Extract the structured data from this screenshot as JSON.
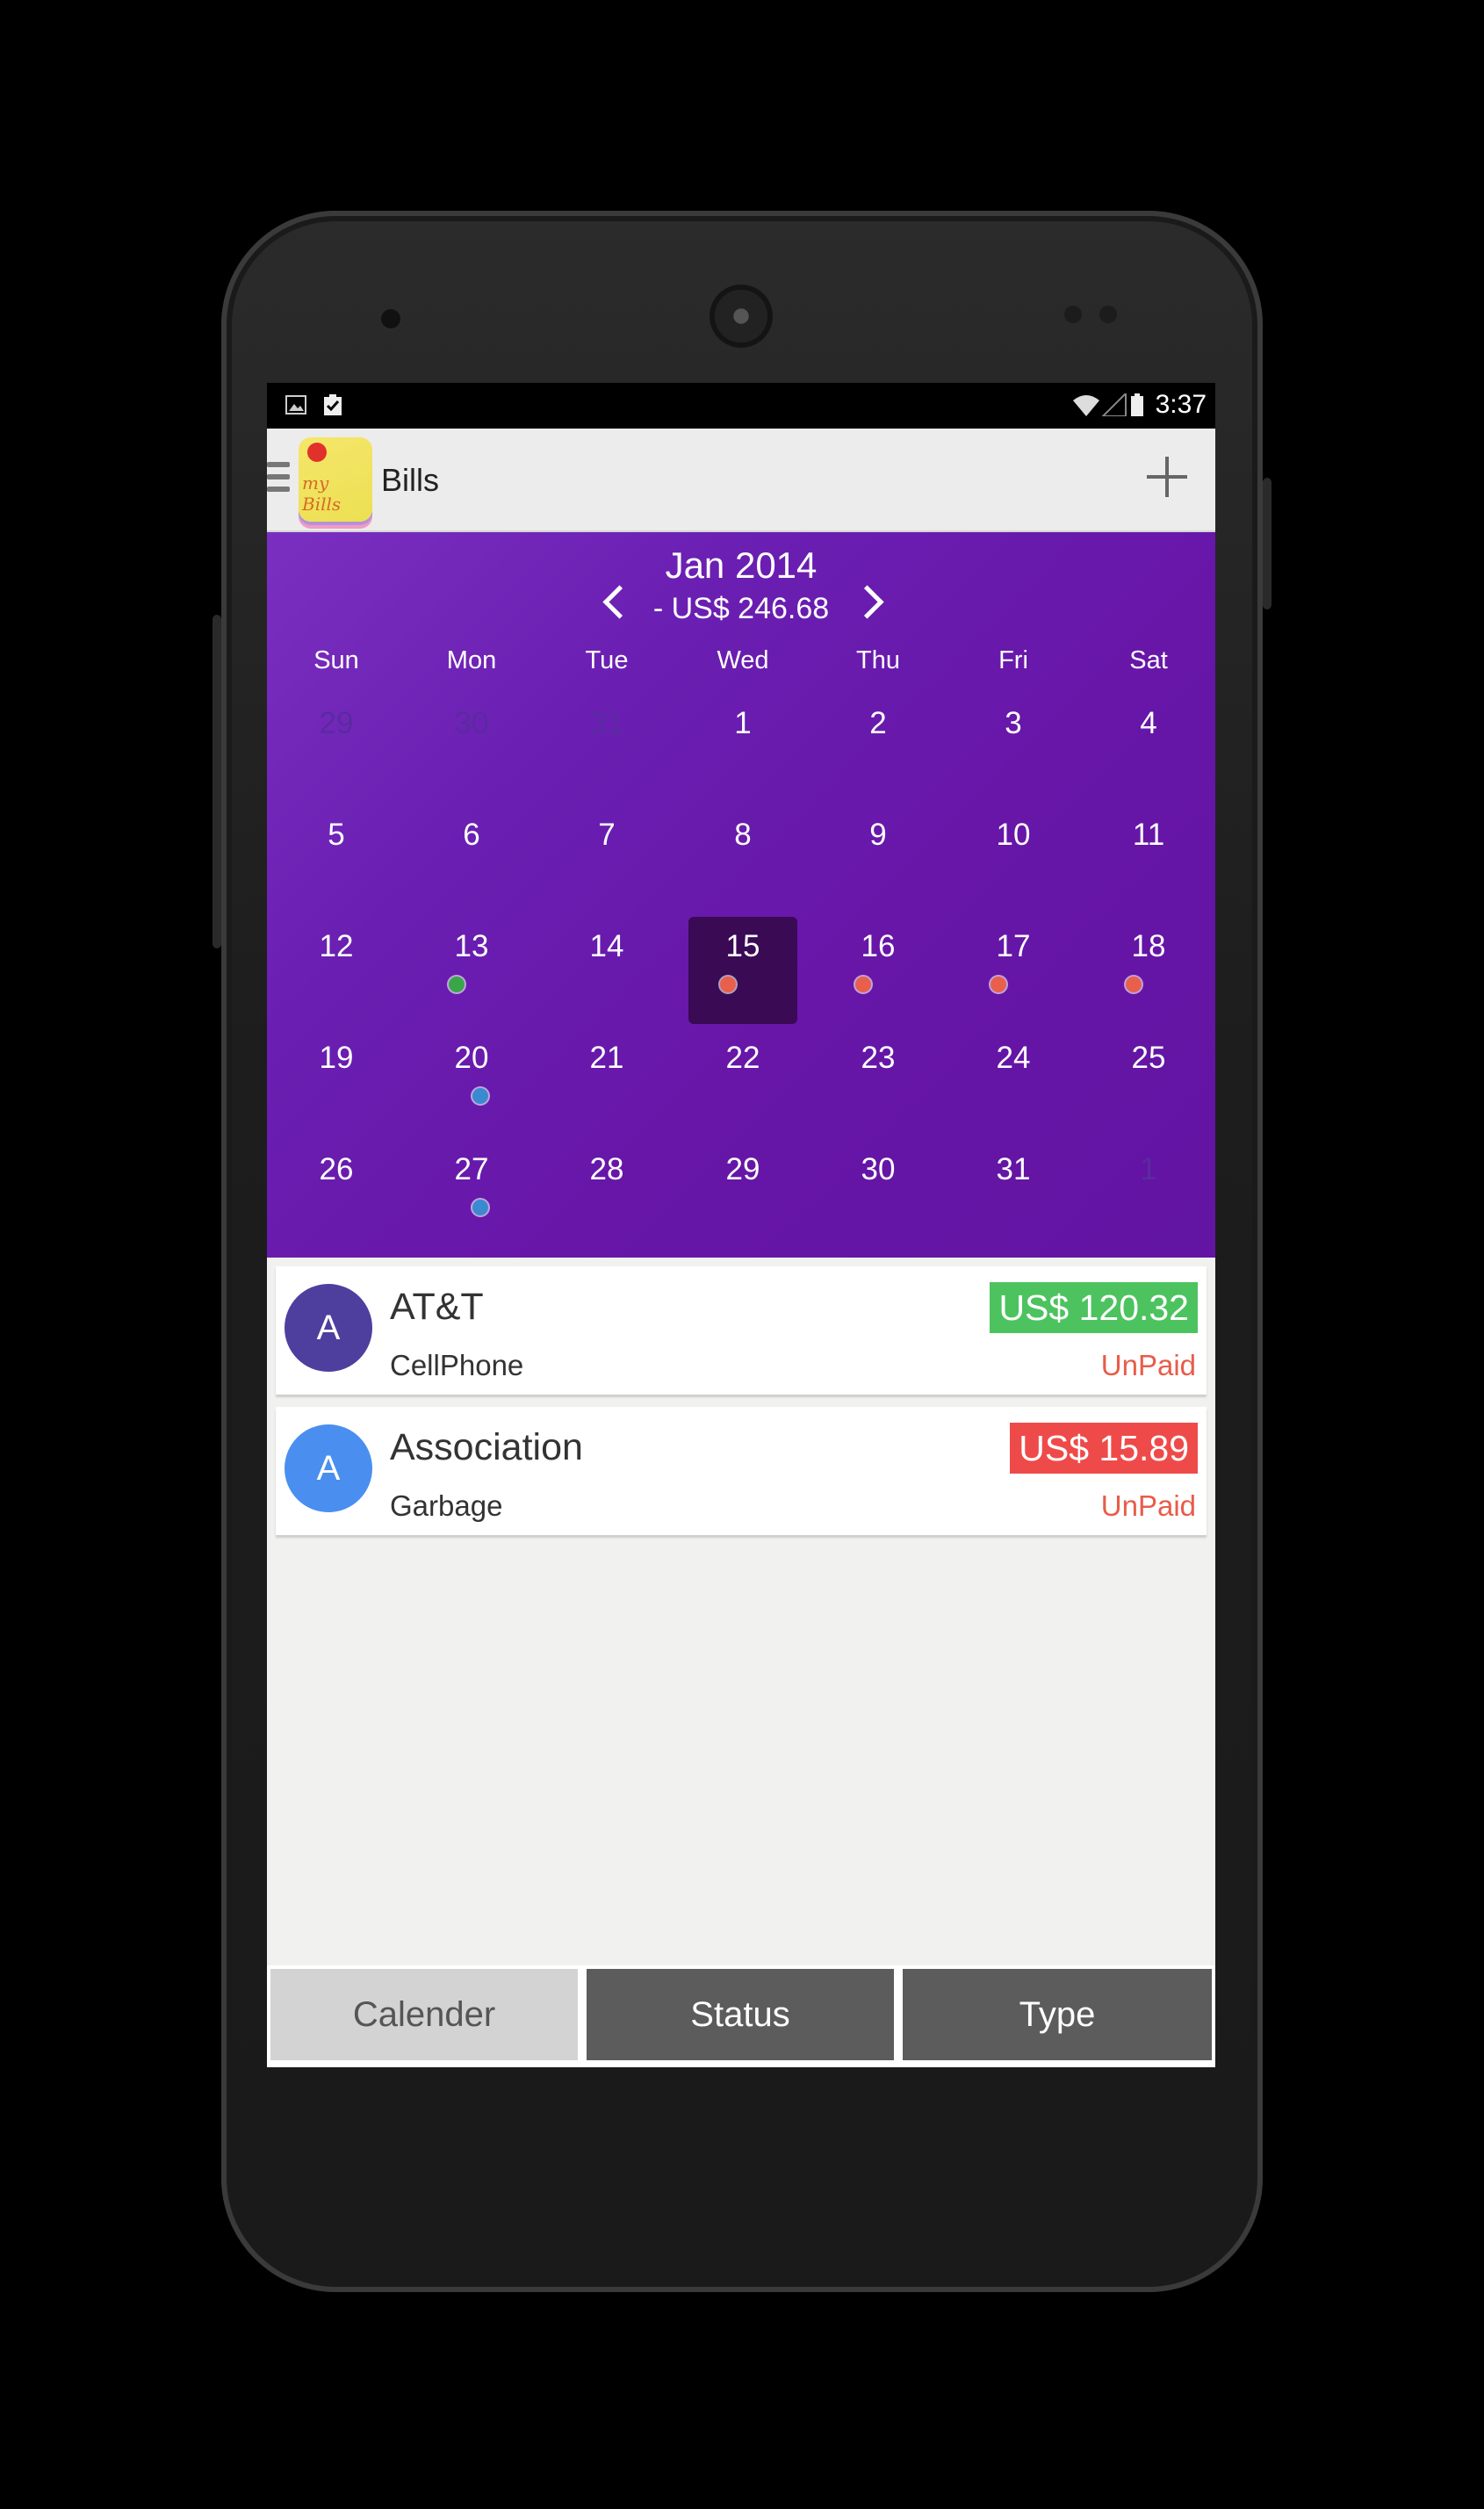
{
  "status_bar": {
    "time": "3:37"
  },
  "app_bar": {
    "title": "Bills",
    "logo_text": "my Bills"
  },
  "calendar": {
    "month": "Jan 2014",
    "total": "- US$ 246.68",
    "weekdays": [
      "Sun",
      "Mon",
      "Tue",
      "Wed",
      "Thu",
      "Fri",
      "Sat"
    ],
    "selected_day": "15",
    "weeks": [
      [
        "29",
        "30",
        "31",
        "1",
        "2",
        "3",
        "4"
      ],
      [
        "5",
        "6",
        "7",
        "8",
        "9",
        "10",
        "11"
      ],
      [
        "12",
        "13",
        "14",
        "15",
        "16",
        "17",
        "18"
      ],
      [
        "19",
        "20",
        "21",
        "22",
        "23",
        "24",
        "25"
      ],
      [
        "26",
        "27",
        "28",
        "29",
        "30",
        "31",
        "1"
      ]
    ],
    "outside_days": [
      [
        0,
        0
      ],
      [
        0,
        1
      ],
      [
        0,
        2
      ],
      [
        4,
        6
      ]
    ],
    "markers": [
      {
        "week": 2,
        "day": 1,
        "color": "#3aa64a"
      },
      {
        "week": 2,
        "day": 3,
        "color": "#e8604c"
      },
      {
        "week": 2,
        "day": 4,
        "color": "#e8604c"
      },
      {
        "week": 2,
        "day": 5,
        "color": "#e8604c"
      },
      {
        "week": 2,
        "day": 6,
        "color": "#e8604c"
      },
      {
        "week": 3,
        "day": 1,
        "color": "#3a8ad0"
      },
      {
        "week": 4,
        "day": 1,
        "color": "#3a8ad0"
      }
    ]
  },
  "bills": [
    {
      "initial": "A",
      "name": "AT&T",
      "category": "CellPhone",
      "amount": "US$ 120.32",
      "status": "UnPaid",
      "avatar_color": "#4e3f9e",
      "amount_color": "#4cc35f"
    },
    {
      "initial": "A",
      "name": "Association",
      "category": "Garbage",
      "amount": "US$ 15.89",
      "status": "UnPaid",
      "avatar_color": "#4a8ff0",
      "amount_color": "#ef4a4a"
    }
  ],
  "tabs": [
    {
      "label": "Calender",
      "active": true
    },
    {
      "label": "Status",
      "active": false
    },
    {
      "label": "Type",
      "active": false
    }
  ],
  "colors": {
    "accent": "#6a1fb2",
    "selected_day": "#3a0a55",
    "unpaid": "#e85c4a"
  }
}
